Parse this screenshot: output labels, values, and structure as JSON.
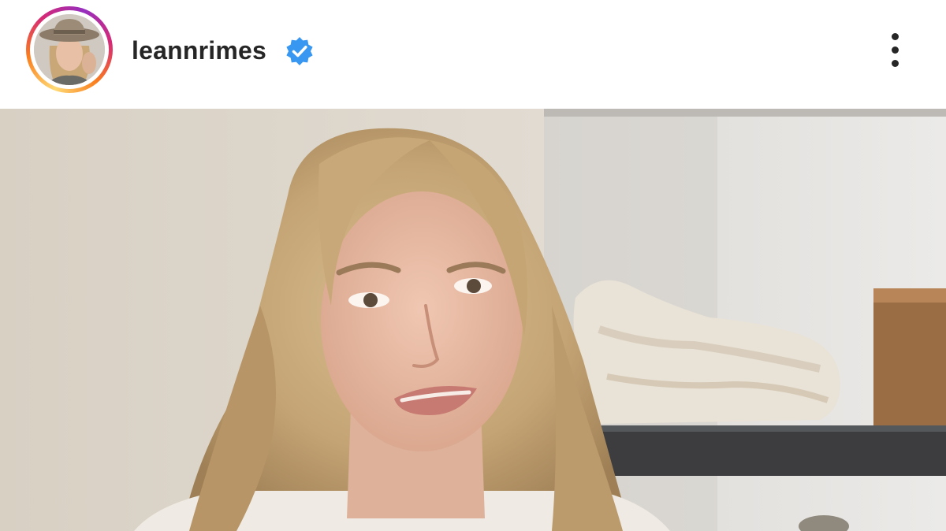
{
  "post": {
    "username": "leannrimes",
    "verified": true,
    "verified_badge_color": "#3897f0",
    "avatar_story_ring": true,
    "menu_icon": "more-vertical-icon"
  },
  "media": {
    "type": "video"
  }
}
